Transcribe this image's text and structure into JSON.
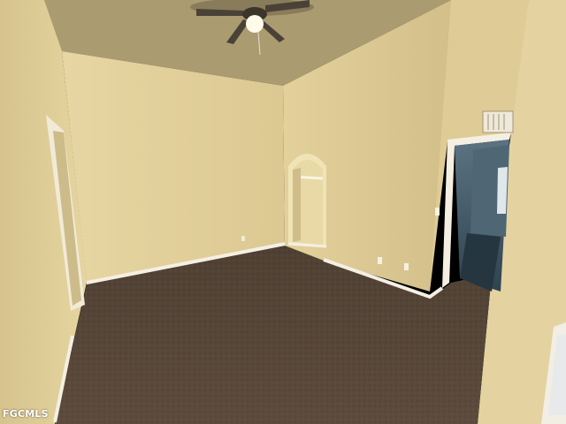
{
  "photo": {
    "subject": "empty-bedroom",
    "watermark": "FGCMLS",
    "colors": {
      "wall": "#e2cf98",
      "wall_shadow": "#cbb781",
      "ceiling": "#b8a67a",
      "carpet": "#5b4a3c",
      "carpet_dark": "#3f3228",
      "baseboard": "#f4efe3",
      "hall_blue": "#3d5563"
    }
  }
}
